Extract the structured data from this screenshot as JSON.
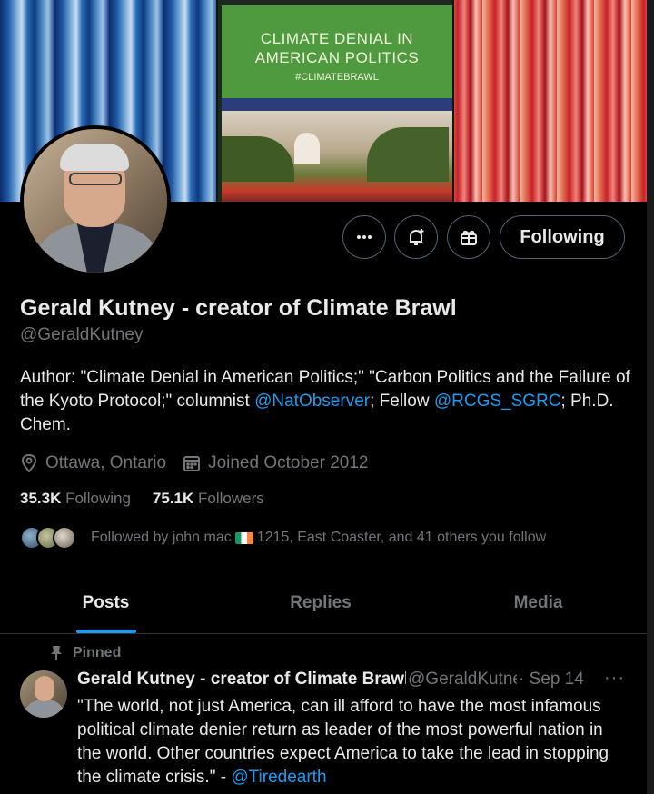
{
  "banner": {
    "book_title_line1": "CLIMATE DENIAL IN",
    "book_title_line2": "AMERICAN POLITICS",
    "book_hashtag": "#CLIMATEBRAWL"
  },
  "actions": {
    "more_icon": "more-horizontal-icon",
    "notify_icon": "bell-plus-icon",
    "gift_icon": "gift-icon",
    "following_label": "Following"
  },
  "profile": {
    "name": "Gerald Kutney - creator of Climate Brawl",
    "handle": "@GeraldKutney",
    "bio_part1": "Author: \"Climate Denial in American Politics;\" \"Carbon Politics and the Failure of the Kyoto Protocol;\" columnist ",
    "bio_link1": "@NatObserver",
    "bio_part2": "; Fellow ",
    "bio_link2": "@RCGS_SGRC",
    "bio_part3": "; Ph.D. Chem.",
    "location": "Ottawa, Ontario",
    "joined": "Joined October 2012"
  },
  "stats": {
    "following_count": "35.3K",
    "following_label": "Following",
    "followers_count": "75.1K",
    "followers_label": "Followers"
  },
  "followed_by": {
    "prefix": "Followed by john mac",
    "suffix": "1215, East Coaster, and 41 others you follow"
  },
  "tabs": [
    {
      "label": "Posts",
      "active": true
    },
    {
      "label": "Replies",
      "active": false
    },
    {
      "label": "Media",
      "active": false
    }
  ],
  "post": {
    "pinned_label": "Pinned",
    "author_name": "Gerald Kutney - creator of Climate Brawl",
    "author_handle": "@GeraldKutney",
    "date": "· Sep 14",
    "more": "···",
    "text": "\"The world, not just America, can ill afford to have the most infamous political climate denier return as leader of the most powerful nation in the world. Other countries expect America to take the lead in stopping the climate crisis.\" - ",
    "mention": "@Tiredearth"
  },
  "colors": {
    "background": "#000000",
    "text_primary": "#e7e9ea",
    "text_secondary": "#71767b",
    "accent": "#1d9bf0",
    "border": "#2f3336"
  }
}
